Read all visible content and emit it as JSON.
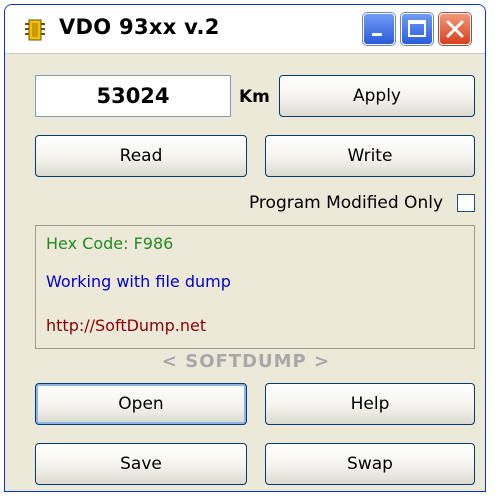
{
  "window": {
    "title": "VDO 93xx v.2"
  },
  "odometer": {
    "value": "53024",
    "unit": "Km",
    "apply_label": "Apply"
  },
  "actions": {
    "read_label": "Read",
    "write_label": "Write"
  },
  "options": {
    "program_modified_only_label": "Program Modified Only",
    "program_modified_only_checked": false
  },
  "log": {
    "lines": [
      {
        "text": "Hex Code: F986",
        "color": "#228b22"
      },
      {
        "text": "Working with file dump",
        "color": "#0000cc"
      },
      {
        "text": "http://SoftDump.net",
        "color": "#8b0000"
      }
    ]
  },
  "brand_text": "< SOFTDUMP >",
  "buttons": {
    "open_label": "Open",
    "help_label": "Help",
    "save_label": "Save",
    "swap_label": "Swap"
  },
  "colors": {
    "titlebar_blue": "#2b5bdc",
    "close_red": "#d6401c",
    "window_bg": "#ece9d8"
  },
  "icons": {
    "app": "chip-icon",
    "minimize": "minimize-icon",
    "maximize": "maximize-icon",
    "close": "close-icon"
  }
}
